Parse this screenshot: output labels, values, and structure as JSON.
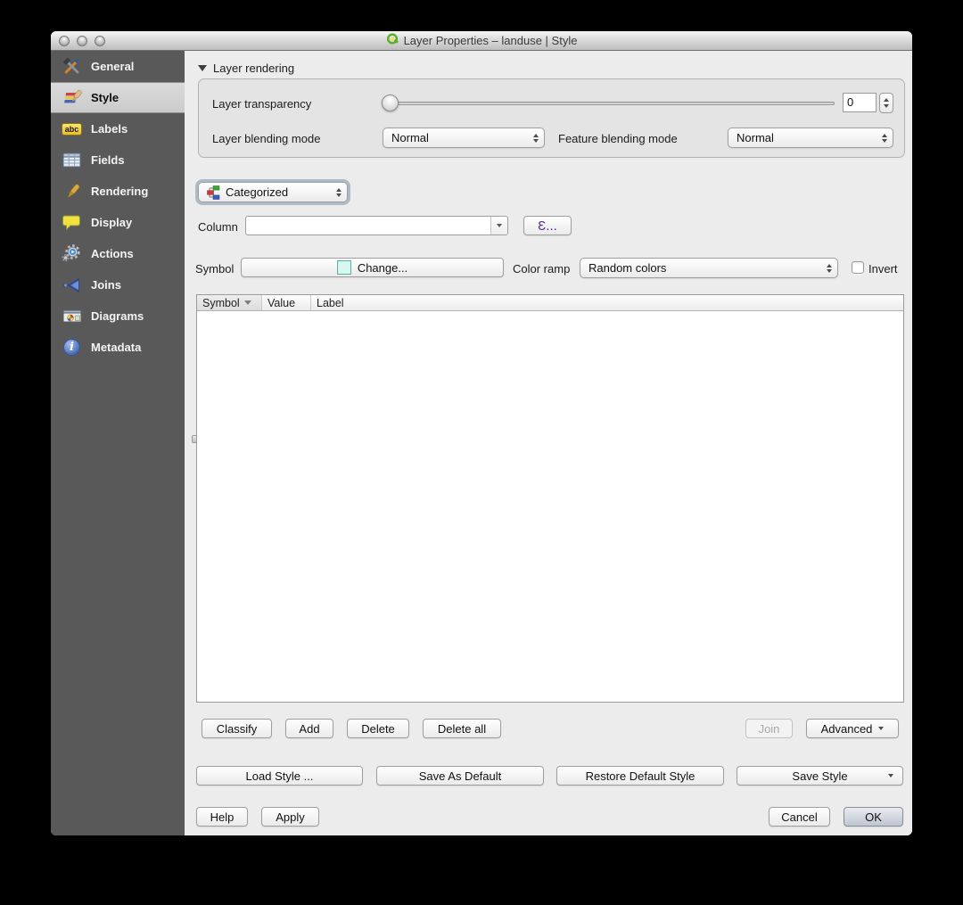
{
  "window": {
    "title": "Layer Properties – landuse | Style",
    "app_icon": "qgis-icon"
  },
  "sidebar": {
    "items": [
      {
        "label": "General",
        "icon": "tools-icon",
        "selected": false
      },
      {
        "label": "Style",
        "icon": "paintbrush-icon",
        "selected": true
      },
      {
        "label": "Labels",
        "icon": "abc-tag-icon",
        "icon_text": "abc",
        "selected": false
      },
      {
        "label": "Fields",
        "icon": "table-icon",
        "selected": false
      },
      {
        "label": "Rendering",
        "icon": "brush-icon",
        "selected": false
      },
      {
        "label": "Display",
        "icon": "speech-bubble-icon",
        "selected": false
      },
      {
        "label": "Actions",
        "icon": "gears-icon",
        "selected": false
      },
      {
        "label": "Joins",
        "icon": "join-arrow-icon",
        "selected": false
      },
      {
        "label": "Diagrams",
        "icon": "diagram-icon",
        "selected": false
      },
      {
        "label": "Metadata",
        "icon": "info-icon",
        "icon_text": "i",
        "selected": false
      }
    ]
  },
  "layer_rendering": {
    "header": "Layer rendering",
    "transparency_label": "Layer transparency",
    "transparency_value": "0",
    "layer_blending_label": "Layer blending mode",
    "layer_blending_value": "Normal",
    "feature_blending_label": "Feature blending mode",
    "feature_blending_value": "Normal"
  },
  "renderer": {
    "type_value": "Categorized",
    "column_label": "Column",
    "column_value": "",
    "expression_button_label": "Ɛ...",
    "symbol_label": "Symbol",
    "change_button_label": "Change...",
    "symbol_swatch_color": "#d6f8ef",
    "color_ramp_label": "Color ramp",
    "color_ramp_value": "Random colors",
    "invert_label": "Invert",
    "invert_checked": false
  },
  "classes_table": {
    "columns": [
      "Symbol",
      "Value",
      "Label"
    ],
    "sorted_by": "Symbol",
    "sort_direction": "descending",
    "rows": []
  },
  "class_buttons": {
    "classify": "Classify",
    "add": "Add",
    "delete": "Delete",
    "delete_all": "Delete all",
    "join": "Join",
    "advanced": "Advanced"
  },
  "style_buttons": {
    "load": "Load Style ...",
    "save_default": "Save As Default",
    "restore_default": "Restore Default Style",
    "save_style": "Save Style"
  },
  "footer": {
    "help": "Help",
    "apply": "Apply",
    "cancel": "Cancel",
    "ok": "OK"
  }
}
